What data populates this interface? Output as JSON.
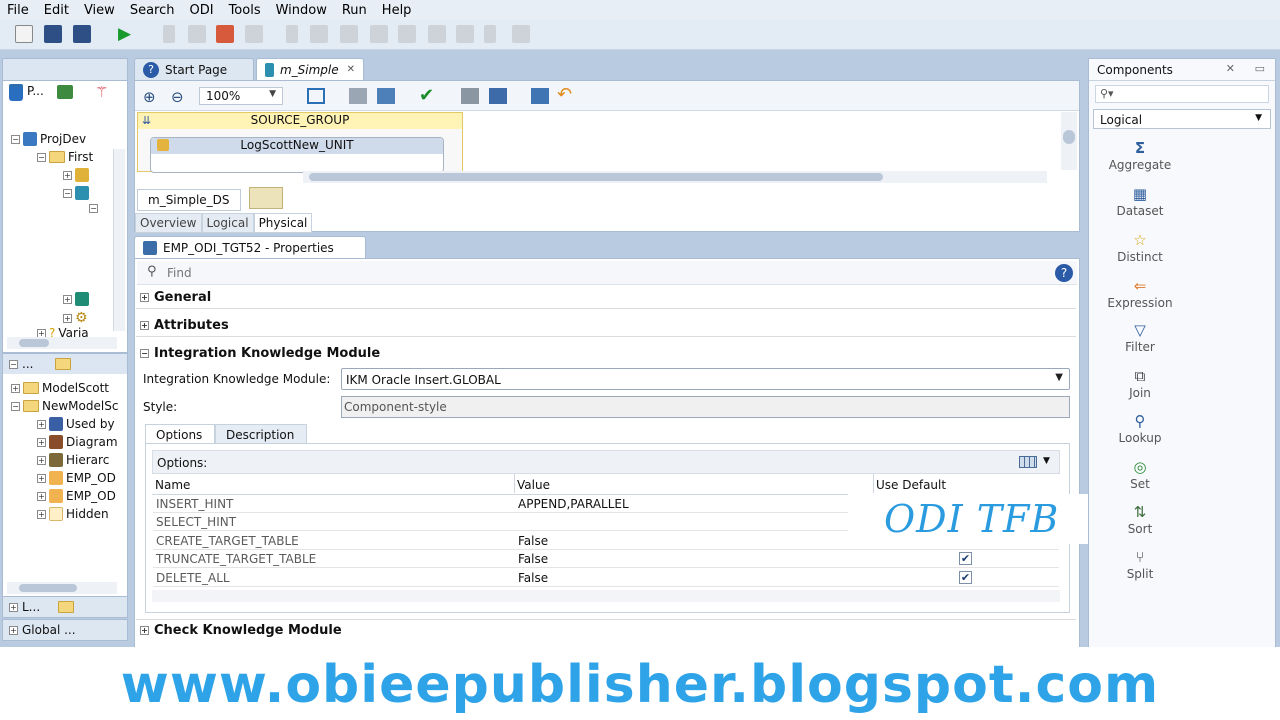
{
  "menu": [
    "File",
    "Edit",
    "View",
    "Search",
    "ODI",
    "Tools",
    "Window",
    "Run",
    "Help"
  ],
  "editor_tabs": {
    "start_page": "Start Page",
    "mapping": "m_Simple"
  },
  "zoom": "100%",
  "diagram": {
    "group": "SOURCE_GROUP",
    "unit": "LogScottNew_UNIT"
  },
  "deployment_tab": "m_Simple_DS",
  "view_tabs": [
    "Overview",
    "Logical",
    "Physical"
  ],
  "left_tree": {
    "header": "P...",
    "items": [
      "ProjDev",
      "First",
      "Varia"
    ],
    "models_header": "...",
    "models": [
      "ModelScott",
      "NewModelSc",
      "Used by",
      "Diagram",
      "Hierarc",
      "EMP_OD",
      "EMP_OD",
      "Hidden"
    ],
    "bottom": [
      "L...",
      "Global ..."
    ]
  },
  "properties": {
    "tab_title": "EMP_ODI_TGT52 - Properties",
    "find_placeholder": "Find",
    "sections": {
      "general": "General",
      "attributes": "Attributes",
      "ikm": "Integration Knowledge Module",
      "ckm": "Check Knowledge Module"
    },
    "ikm_label": "Integration Knowledge Module:",
    "ikm_value": "IKM Oracle Insert.GLOBAL",
    "style_label": "Style:",
    "style_value": "Component-style",
    "subtabs": [
      "Options",
      "Description"
    ],
    "options_label": "Options:",
    "columns": [
      "Name",
      "Value",
      "Use Default"
    ],
    "rows": [
      {
        "name": "INSERT_HINT",
        "value": "APPEND,PARALLEL",
        "default": false,
        "show_check": false
      },
      {
        "name": "SELECT_HINT",
        "value": "",
        "default": false,
        "show_check": false
      },
      {
        "name": "CREATE_TARGET_TABLE",
        "value": "False",
        "default": true,
        "show_check": true
      },
      {
        "name": "TRUNCATE_TARGET_TABLE",
        "value": "False",
        "default": true,
        "show_check": true
      },
      {
        "name": "DELETE_ALL",
        "value": "False",
        "default": true,
        "show_check": true
      }
    ]
  },
  "components": {
    "title": "Components",
    "dropdown": "Logical",
    "items": [
      {
        "label": "Aggregate",
        "icon": "Σ"
      },
      {
        "label": "Dataset",
        "icon": "▦"
      },
      {
        "label": "Distinct",
        "icon": "☆"
      },
      {
        "label": "Expression",
        "icon": "⇐"
      },
      {
        "label": "Filter",
        "icon": "▽"
      },
      {
        "label": "Join",
        "icon": "⧉"
      },
      {
        "label": "Lookup",
        "icon": "⚲"
      },
      {
        "label": "Set",
        "icon": "◎"
      },
      {
        "label": "Sort",
        "icon": "⇅"
      },
      {
        "label": "Split",
        "icon": "⑂"
      }
    ]
  },
  "overlay_text": "ODI TFB",
  "footer_url": "www.obieepublisher.blogspot.com",
  "colors": {
    "accent": "#2b9be0",
    "footer_text": "#2ea3e8",
    "desk": "#b9cbe0"
  }
}
